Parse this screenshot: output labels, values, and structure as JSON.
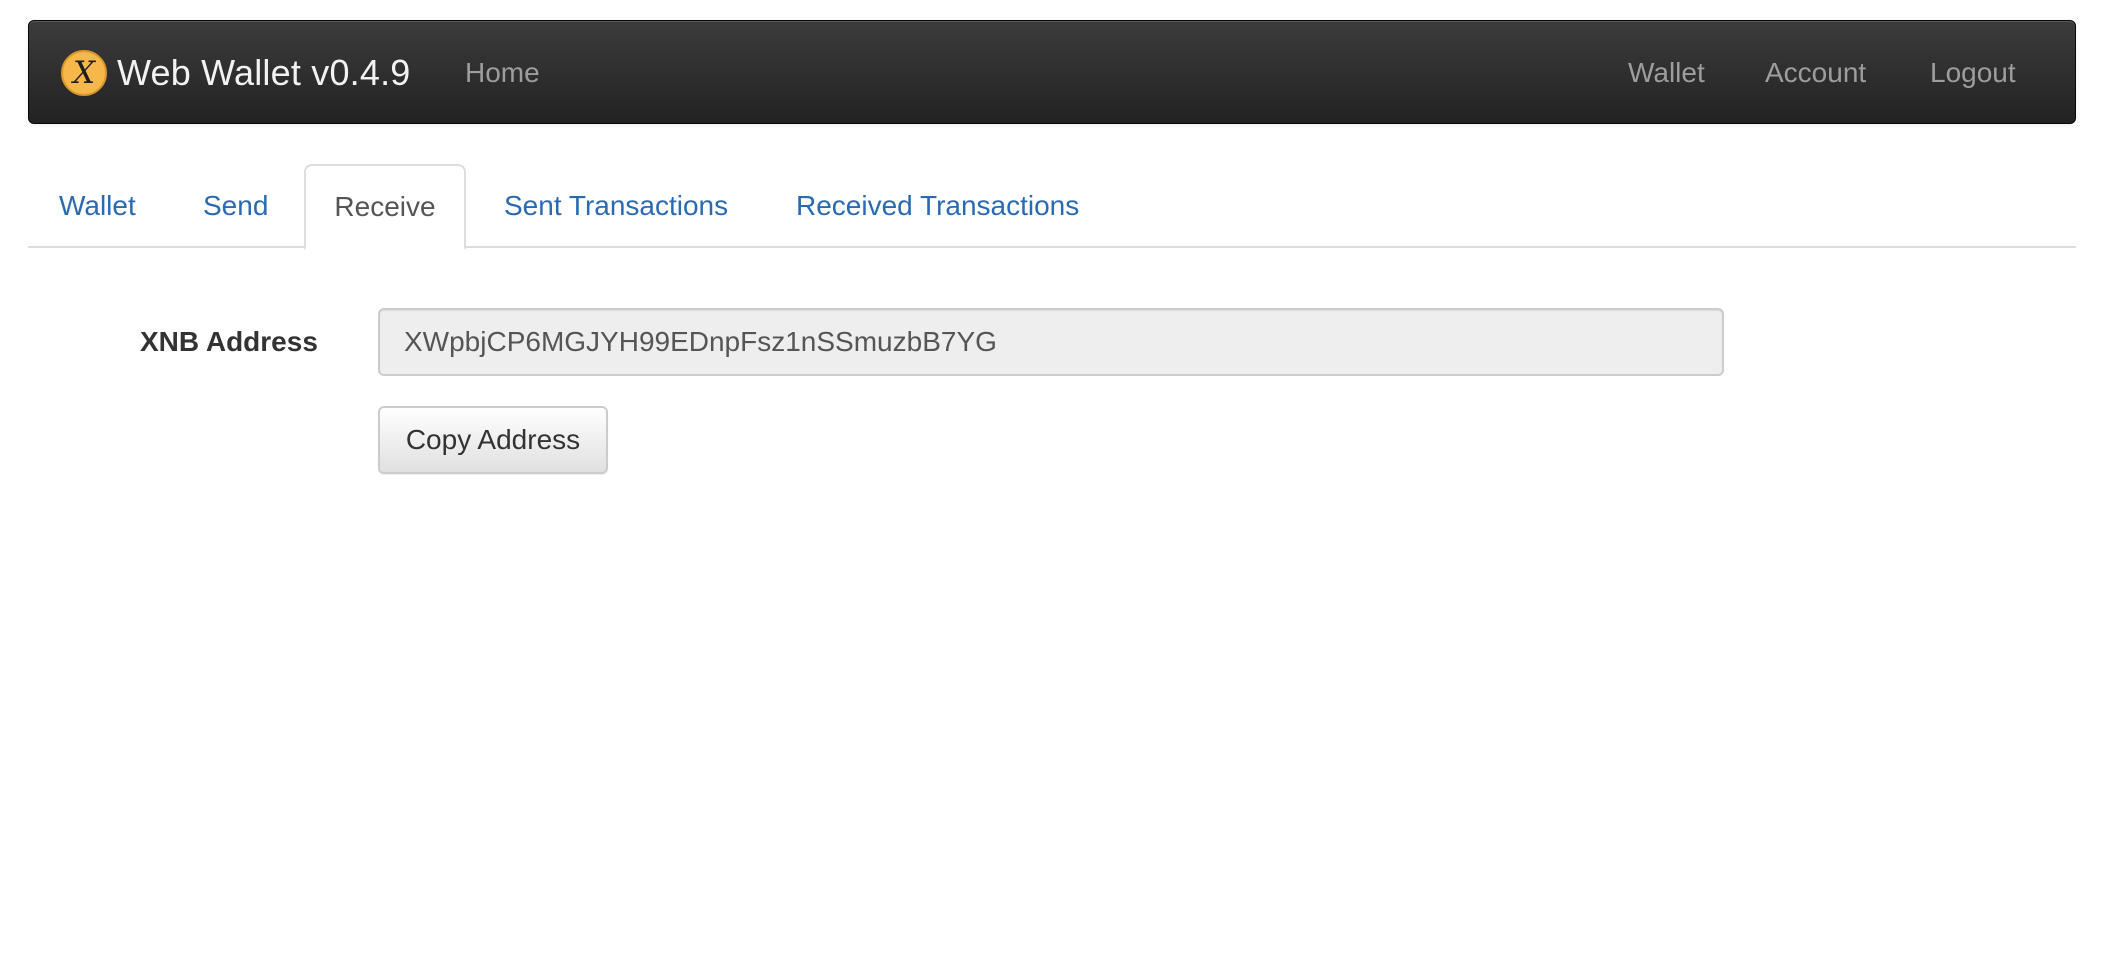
{
  "navbar": {
    "brand": {
      "logo_icon": "x-coin-logo-icon",
      "logo_letter": "X",
      "title": "Web Wallet v0.4.9"
    },
    "left_links": [
      {
        "label": "Home"
      }
    ],
    "right_links": [
      {
        "label": "Wallet"
      },
      {
        "label": "Account"
      },
      {
        "label": "Logout"
      }
    ]
  },
  "tabs": [
    {
      "label": "Wallet",
      "active": false
    },
    {
      "label": "Send",
      "active": false
    },
    {
      "label": "Receive",
      "active": true
    },
    {
      "label": "Sent Transactions",
      "active": false
    },
    {
      "label": "Received Transactions",
      "active": false
    }
  ],
  "receive_form": {
    "address_label": "XNB Address",
    "address_value": "XWpbjCP6MGJYH99EDnpFsz1nSSmuzbB7YG",
    "copy_button_label": "Copy Address"
  },
  "colors": {
    "navbar_bg": "#222222",
    "nav_link": "#9d9d9d",
    "tab_link": "#2a6ab1",
    "tab_active_text": "#555555",
    "logo": "#f7b84b"
  }
}
